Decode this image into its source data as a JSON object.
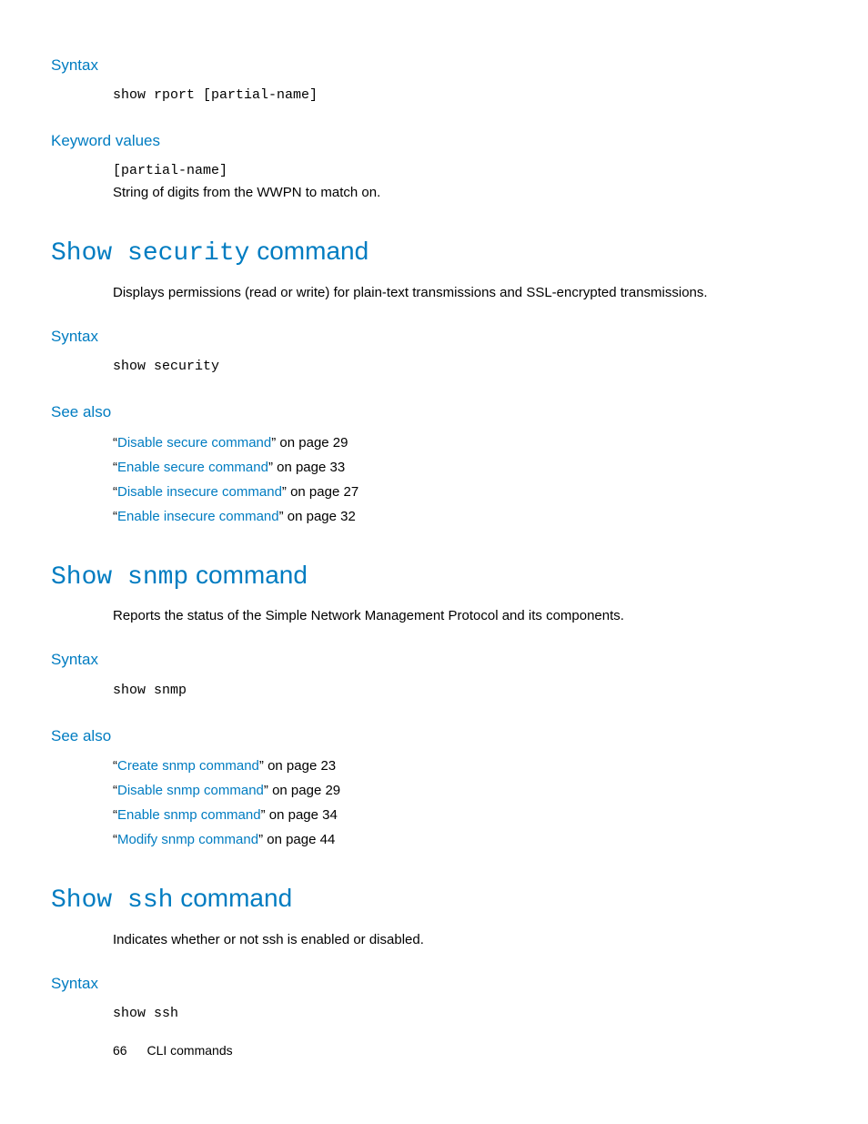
{
  "rport": {
    "syntax_label": "Syntax",
    "syntax_code": "show rport [partial-name]",
    "keyword_label": "Keyword values",
    "keyword_param": "[partial-name]",
    "keyword_desc": "String of digits from the WWPN to match on."
  },
  "security": {
    "title_mono": "Show security",
    "title_rest": " command",
    "desc": "Displays permissions (read or write) for plain-text transmissions and SSL-encrypted transmissions.",
    "syntax_label": "Syntax",
    "syntax_code": "show security",
    "seealso_label": "See also",
    "links": [
      {
        "q1": "“",
        "text": "Disable secure command",
        "q2": "” on page 29"
      },
      {
        "q1": "“",
        "text": "Enable secure command",
        "q2": "” on page 33"
      },
      {
        "q1": "“",
        "text": "Disable insecure command",
        "q2": "” on page 27"
      },
      {
        "q1": "“",
        "text": "Enable insecure command",
        "q2": "” on page 32"
      }
    ]
  },
  "snmp": {
    "title_mono": "Show snmp",
    "title_rest": " command",
    "desc": "Reports the status of the Simple Network Management Protocol and its components.",
    "syntax_label": "Syntax",
    "syntax_code": "show snmp",
    "seealso_label": "See also",
    "links": [
      {
        "q1": "“",
        "text": "Create snmp command",
        "q2": "” on page 23"
      },
      {
        "q1": "“",
        "text": "Disable snmp command",
        "q2": "” on page 29"
      },
      {
        "q1": "“",
        "text": "Enable snmp command",
        "q2": "” on page 34"
      },
      {
        "q1": "“",
        "text": "Modify snmp command",
        "q2": "” on page 44"
      }
    ]
  },
  "ssh": {
    "title_mono": "Show ssh",
    "title_rest": " command",
    "desc": "Indicates whether or not ssh is enabled or disabled.",
    "syntax_label": "Syntax",
    "syntax_code": "show ssh"
  },
  "footer": {
    "page": "66",
    "section": "CLI commands"
  }
}
